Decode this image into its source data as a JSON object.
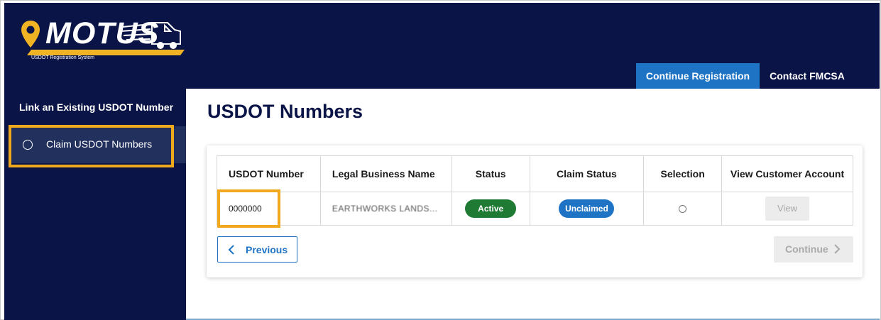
{
  "app": {
    "logo_text": "MOTUS",
    "logo_subtitle": "USDOT Registration System"
  },
  "header": {
    "nav": [
      {
        "label": "Continue Registration",
        "active": true
      },
      {
        "label": "Contact FMCSA",
        "active": false
      }
    ]
  },
  "sidebar": {
    "title": "Link an Existing USDOT Number",
    "items": [
      {
        "label": "Claim USDOT Numbers",
        "selected": false
      }
    ]
  },
  "main": {
    "title": "USDOT Numbers",
    "table": {
      "headers": [
        "USDOT Number",
        "Legal Business Name",
        "Status",
        "Claim Status",
        "Selection",
        "View Customer Account"
      ],
      "rows": [
        {
          "usdot_number": "0000000",
          "legal_business_name": "EARTHWORKS LANDS...",
          "status": "Active",
          "claim_status": "Unclaimed",
          "selected": false,
          "view_label": "View"
        }
      ]
    },
    "buttons": {
      "previous": "Previous",
      "continue": "Continue"
    }
  },
  "colors": {
    "navy": "#0a1446",
    "blue": "#1f73c4",
    "green": "#1f7a33",
    "highlight": "#f0a81c",
    "logo_yellow": "#f0b323"
  }
}
